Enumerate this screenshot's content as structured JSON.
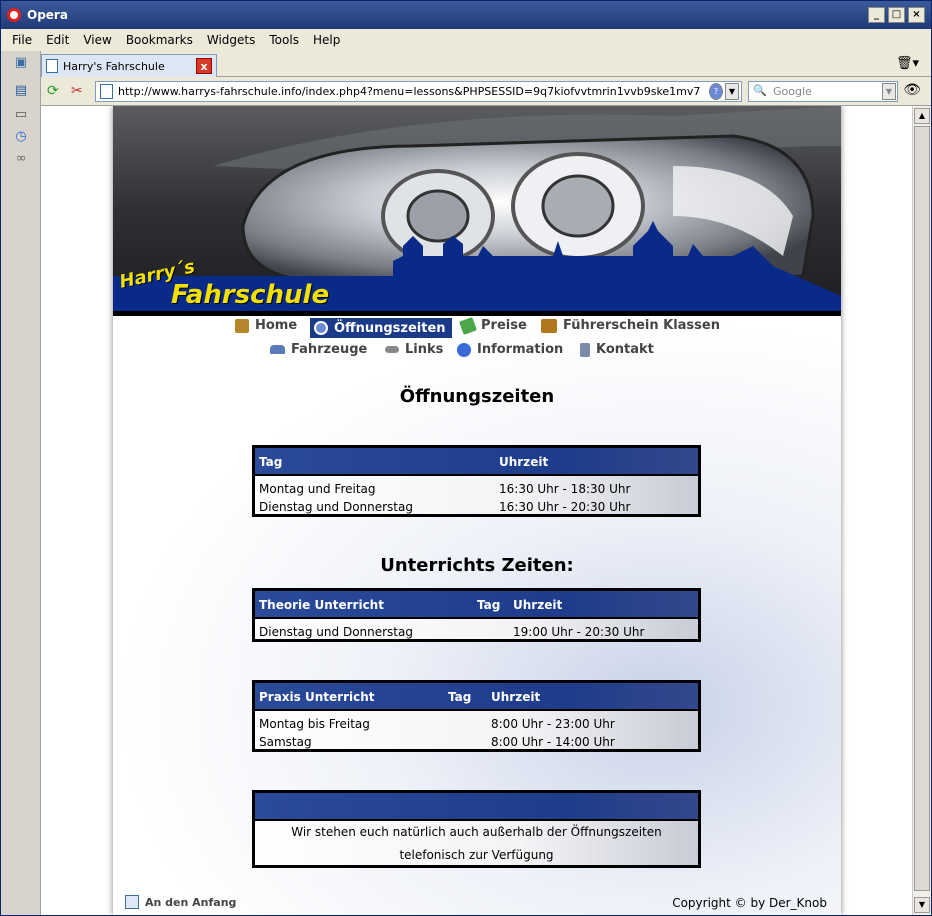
{
  "window": {
    "title": "Opera",
    "controls": [
      "_",
      "□",
      "×"
    ]
  },
  "menu": [
    "File",
    "Edit",
    "View",
    "Bookmarks",
    "Widgets",
    "Tools",
    "Help"
  ],
  "tab": {
    "title": "Harry's Fahrschule",
    "close": "x"
  },
  "address": {
    "url": "http://www.harrys-fahrschule.info/index.php4?menu=lessons&PHPSESSID=9q7kiofvvtmrin1vvb9ske1mv7",
    "search_placeholder": "Google"
  },
  "logo": {
    "line1": "Harry´s",
    "line2": "Fahrschule"
  },
  "nav": {
    "row1": [
      {
        "label": "Home",
        "icon": "book-icon",
        "color": "#b8862a"
      },
      {
        "label": "Öffnungszeiten",
        "icon": "clock-icon",
        "color": "#6a8ad8",
        "active": true
      },
      {
        "label": "Preise",
        "icon": "money-icon",
        "color": "#4aa84a"
      },
      {
        "label": "Führerschein Klassen",
        "icon": "truck-icon",
        "color": "#b0781a"
      }
    ],
    "row2": [
      {
        "label": "Fahrzeuge",
        "icon": "car-icon",
        "color": "#5a7ab8"
      },
      {
        "label": "Links",
        "icon": "chain-icon",
        "color": "#888888"
      },
      {
        "label": "Information",
        "icon": "info-icon",
        "color": "#3a6ad8"
      },
      {
        "label": "Kontakt",
        "icon": "phone-icon",
        "color": "#7a8aa8"
      }
    ]
  },
  "heading1": "Öffnungszeiten",
  "table1": {
    "headers": [
      "Tag",
      "Uhrzeit"
    ],
    "rows": [
      [
        "Montag und Freitag",
        "16:30 Uhr - 18:30 Uhr"
      ],
      [
        "Dienstag und Donnerstag",
        "16:30 Uhr - 20:30 Uhr"
      ]
    ]
  },
  "heading2": "Unterrichts Zeiten:",
  "table2": {
    "headers": [
      "Theorie Unterricht",
      "Tag",
      "Uhrzeit"
    ],
    "rows": [
      [
        "Dienstag und Donnerstag",
        "19:00 Uhr - 20:30 Uhr"
      ]
    ]
  },
  "table3": {
    "headers": [
      "Praxis Unterricht",
      "Tag",
      "Uhrzeit"
    ],
    "rows": [
      [
        "Montag bis Freitag",
        "8:00 Uhr - 23:00 Uhr"
      ],
      [
        "Samstag",
        "8:00 Uhr - 14:00 Uhr"
      ]
    ]
  },
  "notice": {
    "line1": "Wir stehen euch natürlich auch außerhalb der Öffnungszeiten",
    "line2": "telefonisch zur Verfügung"
  },
  "footer": {
    "top_link": "An den Anfang",
    "copyright": "Copyright © by Der_Knob"
  }
}
